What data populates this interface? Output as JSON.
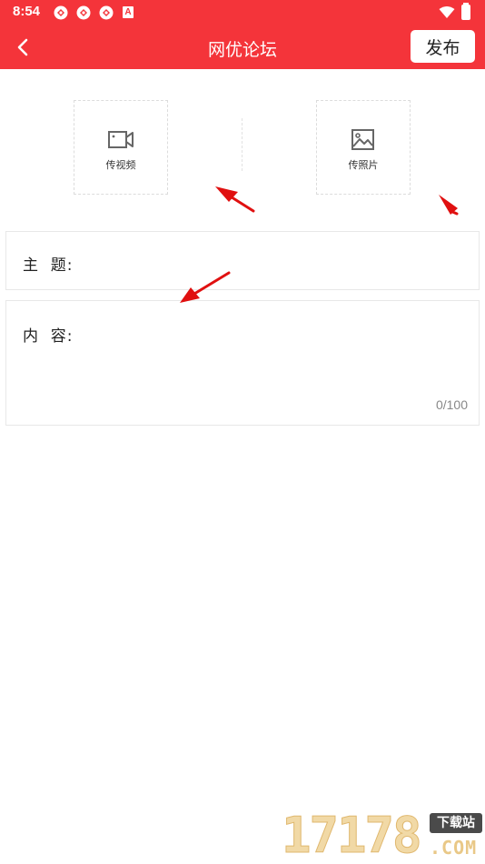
{
  "status_bar": {
    "time": "8:54",
    "notification_icons": [
      "app-notification-icon",
      "app-notification-icon",
      "app-notification-icon"
    ],
    "a_badge": "A"
  },
  "header": {
    "title": "网优论坛",
    "back_icon": "chevron-left-icon",
    "publish_label": "发布",
    "bg_color": "#f4343a"
  },
  "uploads": {
    "video": {
      "label": "传视频",
      "icon": "video-camera-icon"
    },
    "photo": {
      "label": "传照片",
      "icon": "image-icon"
    }
  },
  "form": {
    "subject_label": "主  题:",
    "subject_value": "",
    "content_label": "内  容:",
    "content_value": "",
    "counter": "0/100"
  },
  "watermark": {
    "number": "17178",
    "badge": "下载站",
    "domain": ".COM"
  },
  "annotation_color": "#e01010"
}
